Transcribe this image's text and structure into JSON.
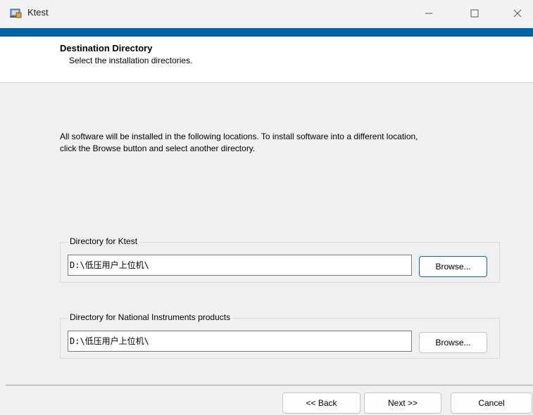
{
  "window": {
    "title": "Ktest",
    "controls": {
      "minimize_icon": "minimize-icon",
      "maximize_icon": "maximize-icon",
      "close_icon": "close-icon"
    },
    "accent_color": "#0060a8"
  },
  "header": {
    "title": "Destination Directory",
    "subtitle": "Select the installation directories."
  },
  "body": {
    "description": "All software will be installed in the following locations. To install software into a different location, click the Browse button and select another directory."
  },
  "groups": [
    {
      "label": "Directory for Ktest",
      "path": "D:\\低压用户上位机\\",
      "browse_label": "Browse..."
    },
    {
      "label": "Directory for National Instruments products",
      "path": "D:\\低压用户上位机\\",
      "browse_label": "Browse..."
    }
  ],
  "footer": {
    "back_label": "<< Back",
    "next_label": "Next >>",
    "cancel_label": "Cancel"
  }
}
